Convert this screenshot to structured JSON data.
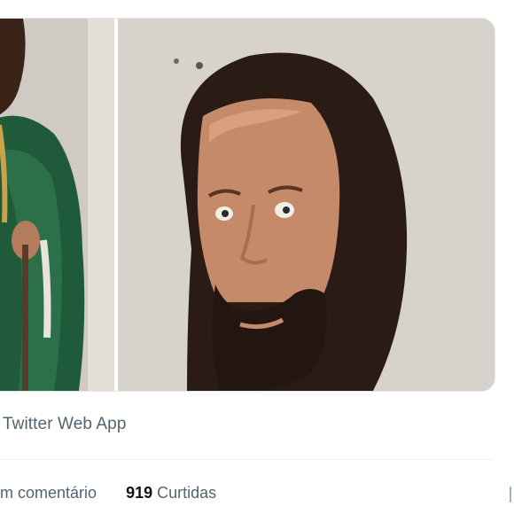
{
  "tweet": {
    "media": {
      "panels": [
        "statue-body-panel",
        "statue-face-panel"
      ]
    },
    "source_label": "Twitter Web App",
    "stats": {
      "comments_label": "m comentário",
      "likes_count": "919",
      "likes_label": "Curtidas"
    }
  },
  "colors": {
    "secondary_text": "#536471",
    "primary_text": "#0f1419",
    "divider": "#eff3f4",
    "robe_green": "#1f5a3a",
    "skin": "#c48a6a",
    "hair": "#2a1b14"
  }
}
